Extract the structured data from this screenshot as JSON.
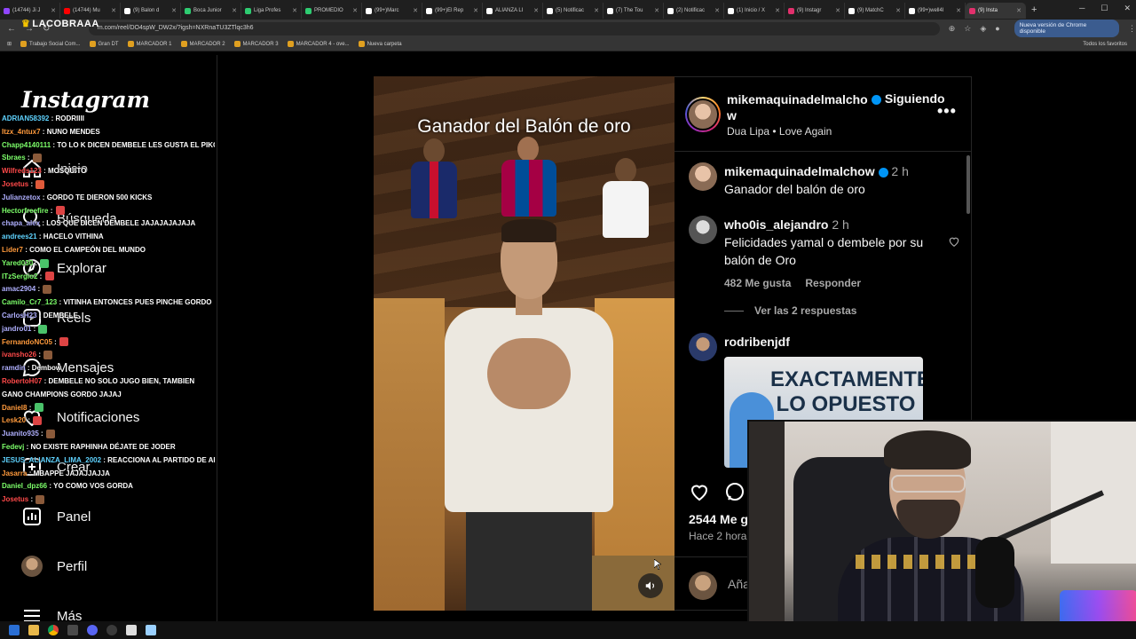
{
  "browser": {
    "tabs": [
      {
        "label": "(14744) Ji J",
        "color": "#9146ff"
      },
      {
        "label": "(14744) Mu",
        "color": "#ff0000"
      },
      {
        "label": "(9) Balon d",
        "color": "#ffffff"
      },
      {
        "label": "Boca Junior",
        "color": "#2ecc71"
      },
      {
        "label": "Liga Profes",
        "color": "#2ecc71"
      },
      {
        "label": "PROMEDIO",
        "color": "#2ecc71"
      },
      {
        "label": "(99+)Marc",
        "color": "#ffffff"
      },
      {
        "label": "(99+)El Rep",
        "color": "#ffffff"
      },
      {
        "label": "ALIANZA LI",
        "color": "#ffffff"
      },
      {
        "label": "(5) Notificac",
        "color": "#ffffff"
      },
      {
        "label": "(7) The Tou",
        "color": "#ffffff"
      },
      {
        "label": "(2) Notificac",
        "color": "#ffffff"
      },
      {
        "label": "(1) Inicio / X",
        "color": "#ffffff"
      },
      {
        "label": "(9) Instagr",
        "color": "#e1306c"
      },
      {
        "label": "(9) MatchC",
        "color": "#ffffff"
      },
      {
        "label": "(99+)well4l",
        "color": "#ffffff"
      },
      {
        "label": "(9) Insta",
        "color": "#e1306c"
      }
    ],
    "url": "m.com/reel/DO4spW_DW2x/?igsh=NXRnaTU3ZTlqc3h6",
    "chrome_update": "Nueva versión de Chrome disponible",
    "bookmarks": [
      "Trabajo Social Com...",
      "Gran DT",
      "MARCADOR 1",
      "MARCADOR 2",
      "MARCADOR 3",
      "MARCADOR 4 - ove...",
      "Nueva carpeta"
    ],
    "all_bookmarks": "Todos los favoritos"
  },
  "streamer_logo": "LACOBRAAA",
  "sidebar": {
    "logo": "Instagram",
    "items": [
      {
        "label": "Inicio",
        "icon": "home-icon"
      },
      {
        "label": "Búsqueda",
        "icon": "search-icon"
      },
      {
        "label": "Explorar",
        "icon": "compass-icon"
      },
      {
        "label": "Reels",
        "icon": "reels-icon"
      },
      {
        "label": "Mensajes",
        "icon": "messenger-icon"
      },
      {
        "label": "Notificaciones",
        "icon": "heart-icon"
      },
      {
        "label": "Crear",
        "icon": "plus-icon"
      },
      {
        "label": "Panel",
        "icon": "chart-icon"
      },
      {
        "label": "Perfil",
        "icon": "avatar"
      },
      {
        "label": "Más",
        "icon": "menu-icon"
      }
    ]
  },
  "chat": [
    {
      "user": "ADRIAN58392",
      "color": "#5fd3ff",
      "msg": "RODRIIII"
    },
    {
      "user": "Itzx_4ntux7",
      "color": "#ff9a3c",
      "msg": "NUNO MENDES"
    },
    {
      "user": "Chapp4140111",
      "color": "#7dff6a",
      "msg": "TO LO K DICEN DEMBELE LES GUSTA EL PIKO"
    },
    {
      "user": "Sbraes",
      "color": "#7dff6a",
      "msg": ""
    },
    {
      "user": "Wilfreds123",
      "color": "#ff4a4a",
      "msg": "MOSQUITO"
    },
    {
      "user": "Josetus",
      "color": "#ff4a4a",
      "msg": ""
    },
    {
      "user": "Julianzetox",
      "color": "#b0b0ff",
      "msg": "GORDO TE DIERON 500 KICKS"
    },
    {
      "user": "Hectorfreefire",
      "color": "#7dff6a",
      "msg": ""
    },
    {
      "user": "chapa_alex",
      "color": "#b0b0ff",
      "msg": "LOS QUE DICEN DEMBELE JAJAJAJAJAJA"
    },
    {
      "user": "andrees21",
      "color": "#5fd3ff",
      "msg": "HACELO VITHINA"
    },
    {
      "user": "Lider7",
      "color": "#ff9a3c",
      "msg": "COMO EL CAMPEÓN DEL MUNDO"
    },
    {
      "user": "Yared030",
      "color": "#7dff6a",
      "msg": ""
    },
    {
      "user": "ITzSergio2",
      "color": "#7dff6a",
      "msg": ""
    },
    {
      "user": "amac2904",
      "color": "#b0b0ff",
      "msg": ""
    },
    {
      "user": "Camilo_Cr7_123",
      "color": "#7dff6a",
      "msg": "VITINHA ENTONCES PUES PINCHE GORDO"
    },
    {
      "user": "CarlosH23",
      "color": "#b0b0ff",
      "msg": "DEMBELE"
    },
    {
      "user": "jandro01",
      "color": "#b0b0ff",
      "msg": ""
    },
    {
      "user": "FernandoNC05",
      "color": "#ff9a3c",
      "msg": ""
    },
    {
      "user": "ivansho26",
      "color": "#ff4a4a",
      "msg": ""
    },
    {
      "user": "ramdin",
      "color": "#b0b0ff",
      "msg": "Dembow"
    },
    {
      "user": "RobertoH07",
      "color": "#ff4a4a",
      "msg": "DEMBELE NO SOLO JUGO BIEN, TAMBIEN GANO CHAMPIONS GORDO JAJAJ"
    },
    {
      "user": "Daniel8",
      "color": "#ff9a3c",
      "msg": ""
    },
    {
      "user": "Lesk20",
      "color": "#ff9a3c",
      "msg": ""
    },
    {
      "user": "Juanito935",
      "color": "#b0b0ff",
      "msg": ""
    },
    {
      "user": "Fedevj",
      "color": "#7dff6a",
      "msg": "NO EXISTE RAPHINHA DÉJATE DE JODER"
    },
    {
      "user": "JESUS_ALIANZA_LIMA_2002",
      "color": "#5fd3ff",
      "msg": "REACCIONA AL PARTIDO DE ALIANZA GORDO"
    },
    {
      "user": "Jasarra",
      "color": "#ff9a3c",
      "msg": "MBAPPE JAJAJJAJJA"
    },
    {
      "user": "Daniel_dpz66",
      "color": "#7dff6a",
      "msg": "YO COMO VOS GORDA"
    },
    {
      "user": "Josetus",
      "color": "#ff4a4a",
      "msg": ""
    }
  ],
  "reel": {
    "title": "Ganador del Balón de oro"
  },
  "post": {
    "author": "mikemaquinadelmalchow",
    "follow_status": "Siguiendo",
    "song": "Dua Lipa • Love Again",
    "caption_user": "mikemaquinadelmalchow",
    "caption_time": "2 h",
    "caption": "Ganador del balón de oro",
    "comments": [
      {
        "user": "who0is_alejandro",
        "time": "2 h",
        "text": "Felicidades yamal o dembele por su balón de Oro",
        "likes": "482 Me gusta",
        "reply": "Responder"
      },
      {
        "user": "rodribenjdf",
        "time": "",
        "text": "",
        "likes": "",
        "reply": ""
      }
    ],
    "view_replies": "Ver las 2 respuestas",
    "meme_text": "EXACTAMENTE LO OPUESTO",
    "likes_count": "2544 Me g",
    "date": "Hace 2 hora",
    "add_comment_placeholder": "Aña"
  },
  "colors": {
    "accent_blue": "#0095f6",
    "secondary_text": "#a8a8a8",
    "border": "#262626"
  }
}
